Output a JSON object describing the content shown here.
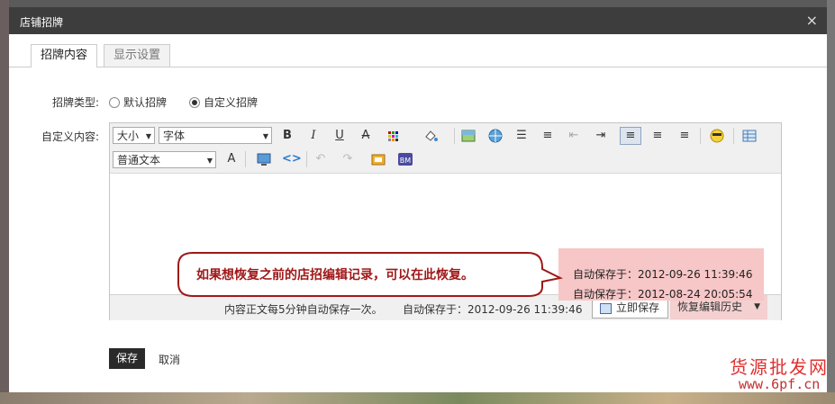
{
  "dialog": {
    "title": "店铺招牌"
  },
  "tabs": [
    {
      "label": "招牌内容"
    },
    {
      "label": "显示设置"
    }
  ],
  "form": {
    "type_label": "招牌类型:",
    "type_options": [
      "默认招牌",
      "自定义招牌"
    ],
    "selected_type": "自定义招牌",
    "content_label": "自定义内容:"
  },
  "toolbar": {
    "size_select": "大小",
    "font_select": "字体",
    "format_select": "普通文本",
    "buttons": [
      "bold",
      "italic",
      "underline",
      "strikethrough",
      "font-color",
      "highlight",
      "image",
      "link",
      "bulleted-list",
      "numbered-list",
      "outdent",
      "indent",
      "align-left",
      "align-center",
      "align-right",
      "emoticon",
      "table",
      "spell-check",
      "media",
      "source-code",
      "undo",
      "redo",
      "flash",
      "bm"
    ]
  },
  "statusbar": {
    "autosave_note": "内容正文每5分钟自动保存一次。",
    "autosave_time": "自动保存于：2012-09-26 11:39:46",
    "save_now": "立即保存",
    "restore_history": "恢复编辑历史"
  },
  "history": {
    "items": [
      "自动保存于：2012-09-26 11:39:46",
      "自动保存于：2012-08-24 20:05:54"
    ]
  },
  "callout": {
    "text": "如果想恢复之前的店招编辑记录，可以在此恢复。"
  },
  "actions": {
    "save": "保存",
    "cancel": "取消"
  },
  "watermark": {
    "line1": "货源批发网",
    "line2": "www.6pf.cn"
  }
}
